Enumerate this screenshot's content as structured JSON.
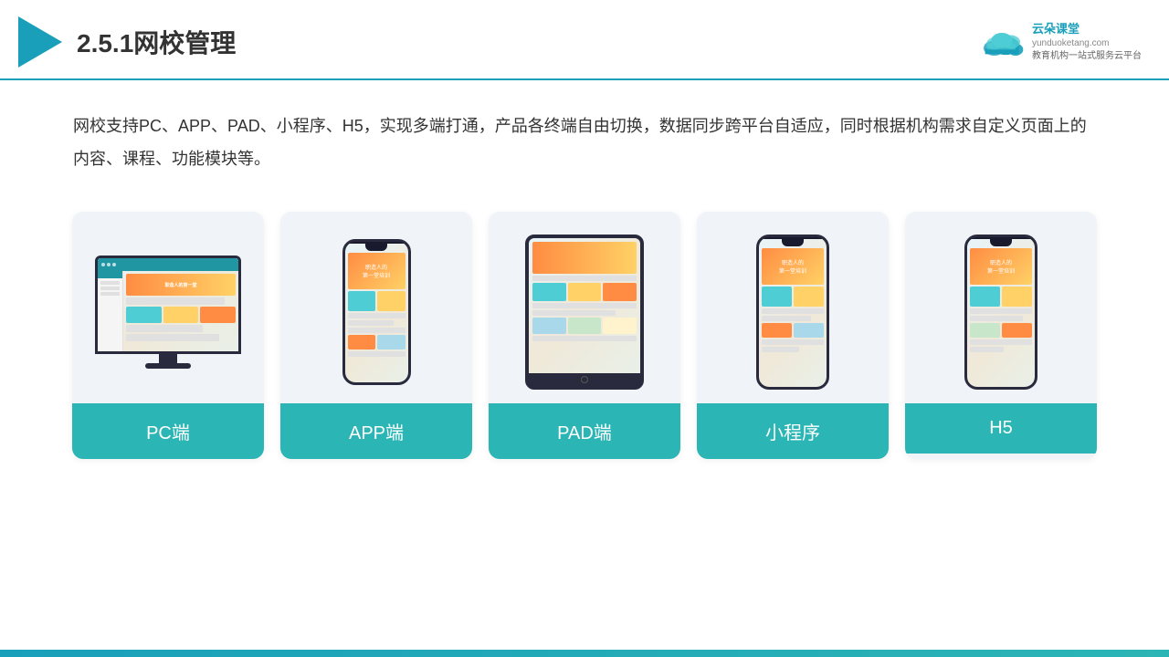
{
  "header": {
    "title": "2.5.1网校管理",
    "brand": {
      "name": "云朵课堂",
      "subtitle_line1": "教育机构一站",
      "subtitle_line2": "式服务云平台",
      "url": "yunduoketang.com"
    }
  },
  "description": "网校支持PC、APP、PAD、小程序、H5，实现多端打通，产品各终端自由切换，数据同步跨平台自适应，同时根据机构需求自定义页面上的内容、课程、功能模块等。",
  "cards": [
    {
      "id": "pc",
      "label": "PC端",
      "type": "monitor"
    },
    {
      "id": "app",
      "label": "APP端",
      "type": "phone"
    },
    {
      "id": "pad",
      "label": "PAD端",
      "type": "tablet"
    },
    {
      "id": "miniprogram",
      "label": "小程序",
      "type": "phone"
    },
    {
      "id": "h5",
      "label": "H5",
      "type": "phone"
    }
  ],
  "colors": {
    "accent": "#1a9fba",
    "teal": "#2cb5b5",
    "card_bg": "#f0f4f8"
  }
}
